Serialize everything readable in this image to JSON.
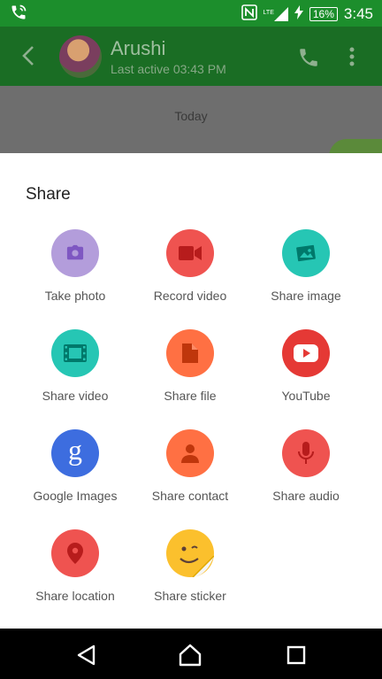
{
  "status_bar": {
    "battery": "16%",
    "network": "LTE",
    "time": "3:45"
  },
  "header": {
    "contact_name": "Arushi",
    "status": "Last active 03:43 PM"
  },
  "chat": {
    "date_divider": "Today"
  },
  "share_sheet": {
    "title": "Share",
    "items": [
      {
        "label": "Take photo",
        "color": "#b39ddb",
        "icon": "camera-icon"
      },
      {
        "label": "Record video",
        "color": "#ef5350",
        "icon": "video-camera-icon"
      },
      {
        "label": "Share image",
        "color": "#26c6b4",
        "icon": "image-icon"
      },
      {
        "label": "Share video",
        "color": "#26c6b4",
        "icon": "film-icon"
      },
      {
        "label": "Share file",
        "color": "#ff7043",
        "icon": "file-icon"
      },
      {
        "label": "YouTube",
        "color": "#e53935",
        "icon": "youtube-icon"
      },
      {
        "label": "Google Images",
        "color": "#3d6ddf",
        "icon": "google-g-icon"
      },
      {
        "label": "Share contact",
        "color": "#ff7043",
        "icon": "person-icon"
      },
      {
        "label": "Share audio",
        "color": "#ef5350",
        "icon": "microphone-icon"
      },
      {
        "label": "Share location",
        "color": "#ef5350",
        "icon": "location-pin-icon"
      },
      {
        "label": "Share sticker",
        "color": "#fbc02d",
        "icon": "sticker-icon"
      }
    ]
  }
}
